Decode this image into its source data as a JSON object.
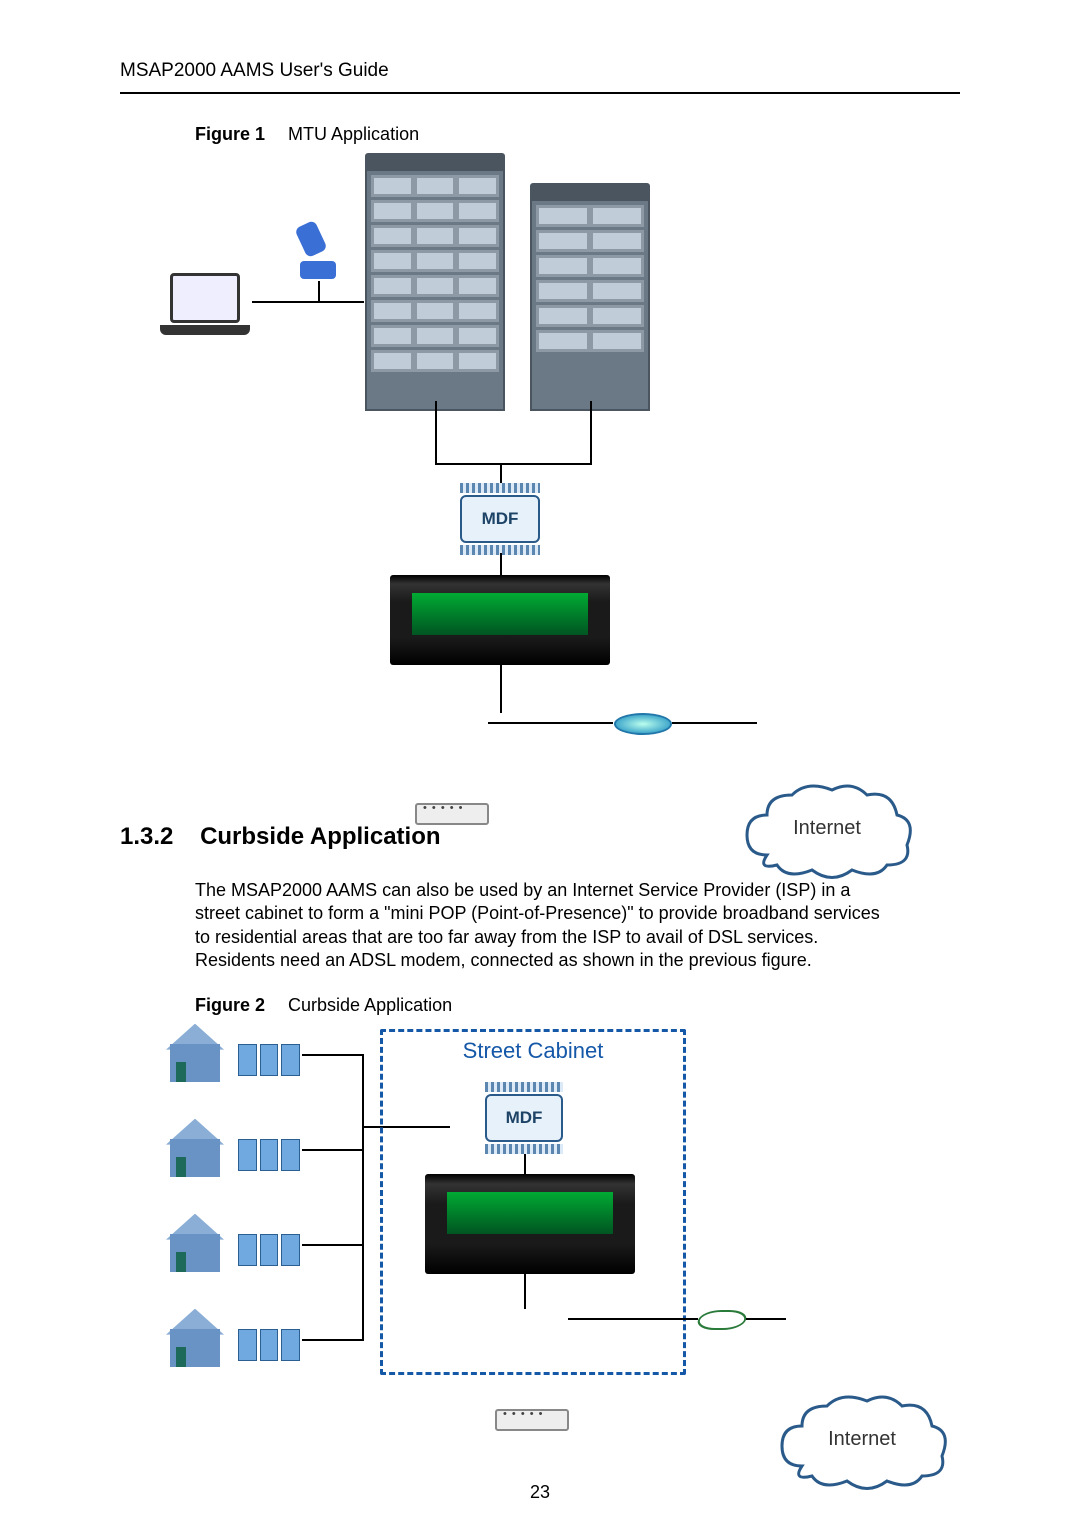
{
  "header": "MSAP2000 AAMS User's Guide",
  "figure1": {
    "label": "Figure 1",
    "caption": "MTU Application",
    "mdf": "MDF",
    "internet": "Internet"
  },
  "section": {
    "number": "1.3.2",
    "title": "Curbside Application"
  },
  "paragraph": "The MSAP2000 AAMS can also be used by an Internet Service Provider (ISP) in a street cabinet to form a \"mini POP (Point-of-Presence)\" to provide broadband services to residential areas that are too far away from the ISP to avail of DSL services. Residents need an ADSL modem, connected as shown in the previous figure.",
  "figure2": {
    "label": "Figure 2",
    "caption": "Curbside Application",
    "cabinet": "Street Cabinet",
    "mdf": "MDF",
    "internet": "Internet"
  },
  "page_number": "23"
}
